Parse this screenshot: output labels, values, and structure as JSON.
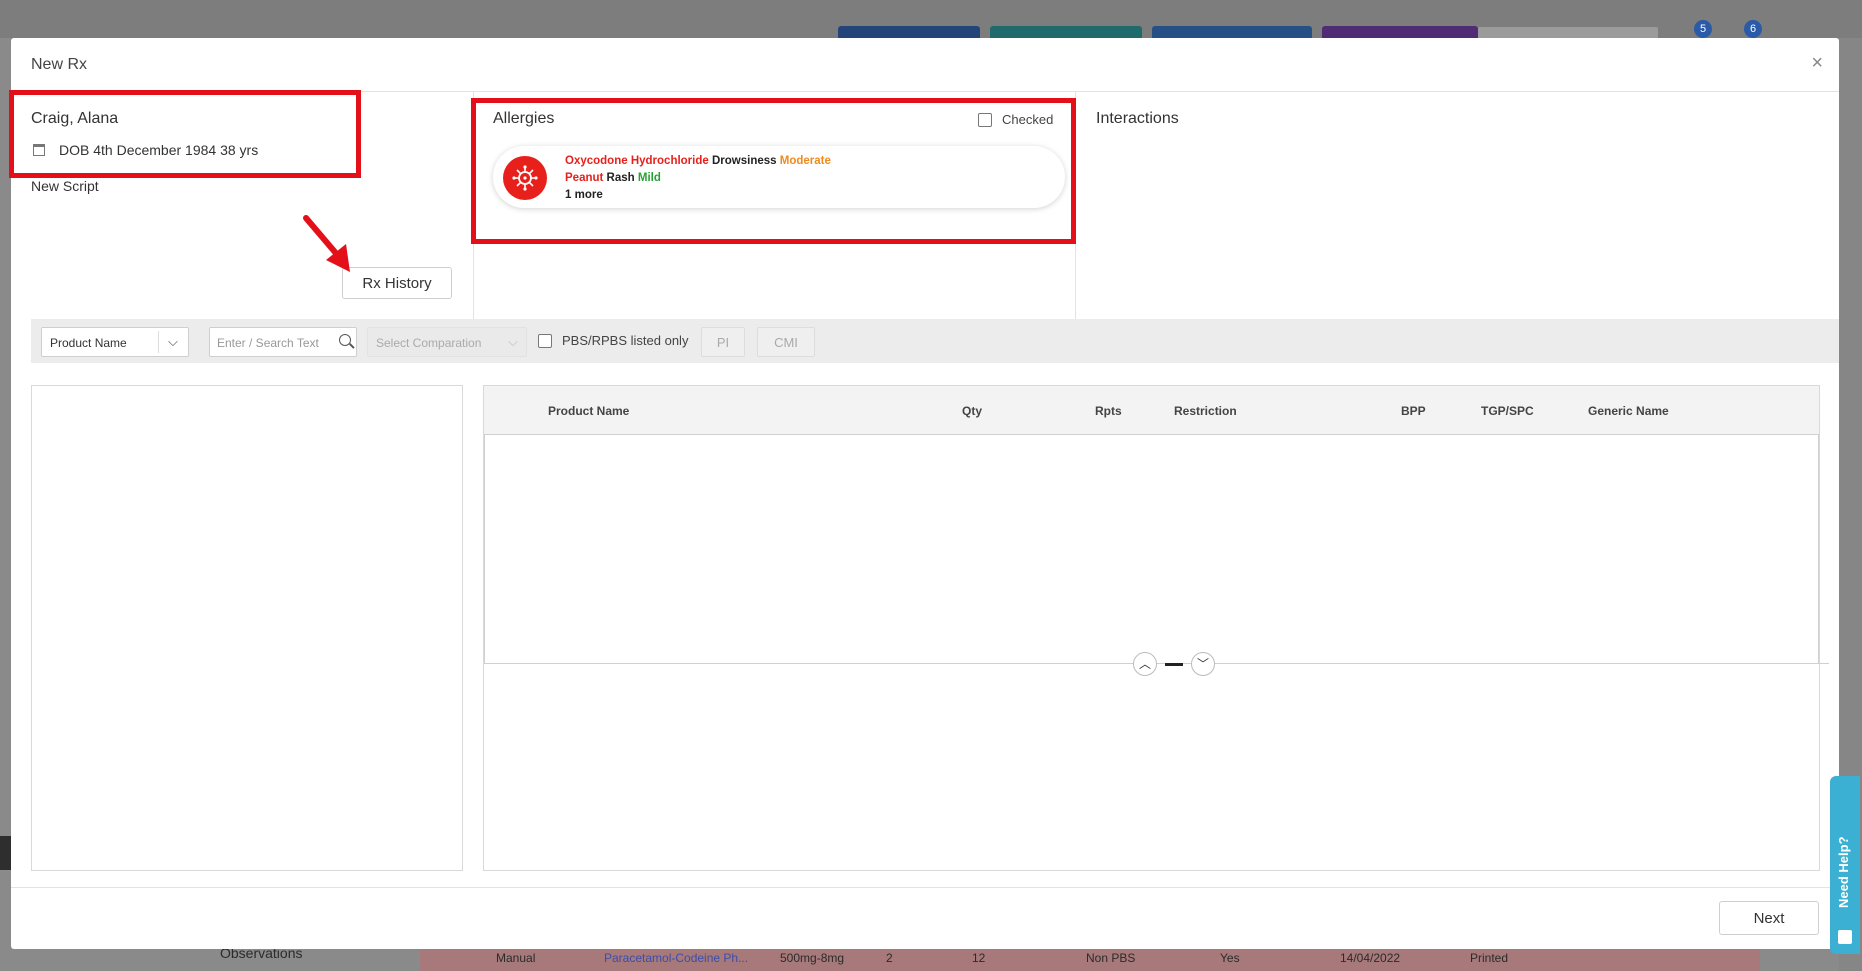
{
  "background": {
    "badges": [
      "5",
      "6"
    ],
    "observations_label": "Observations",
    "table_row": {
      "source": "Manual",
      "drug": "Paracetamol-Codeine Ph...",
      "strength": "500mg-8mg",
      "qty": "2",
      "rpts": "12",
      "pbs": "Non PBS",
      "flag": "Yes",
      "date": "14/04/2022",
      "status": "Printed"
    }
  },
  "modal": {
    "title": "New Rx",
    "close_icon": "×"
  },
  "patient": {
    "name": "Craig, Alana",
    "dob": "DOB 4th December 1984 38 yrs",
    "new_script_label": "New Script",
    "rx_history_label": "Rx History"
  },
  "allergies": {
    "title": "Allergies",
    "checked_label": "Checked",
    "items": [
      {
        "drug": "Oxycodone Hydrochloride",
        "reaction": "Drowsiness",
        "severity": "Moderate"
      },
      {
        "drug": "Peanut",
        "reaction": "Rash",
        "severity": "Mild"
      }
    ],
    "more_label": "1 more"
  },
  "interactions": {
    "title": "Interactions"
  },
  "toolbar": {
    "search_by": "Product Name",
    "search_placeholder": "Enter / Search Text",
    "compare_placeholder": "Select Comparation",
    "pbs_label": "PBS/RPBS listed only",
    "pi_label": "PI",
    "cmi_label": "CMI"
  },
  "grid": {
    "columns": [
      "Product Name",
      "Qty",
      "Rpts",
      "Restriction",
      "BPP",
      "TGP/SPC",
      "Generic Name"
    ]
  },
  "footer": {
    "next_label": "Next"
  },
  "help": {
    "label": "Need Help?"
  },
  "colors": {
    "annotation_red": "#e3101a",
    "allergy_red": "#e8201b",
    "moderate": "#f08a1c",
    "mild": "#27a334",
    "help_tab": "#3bb0d3"
  }
}
